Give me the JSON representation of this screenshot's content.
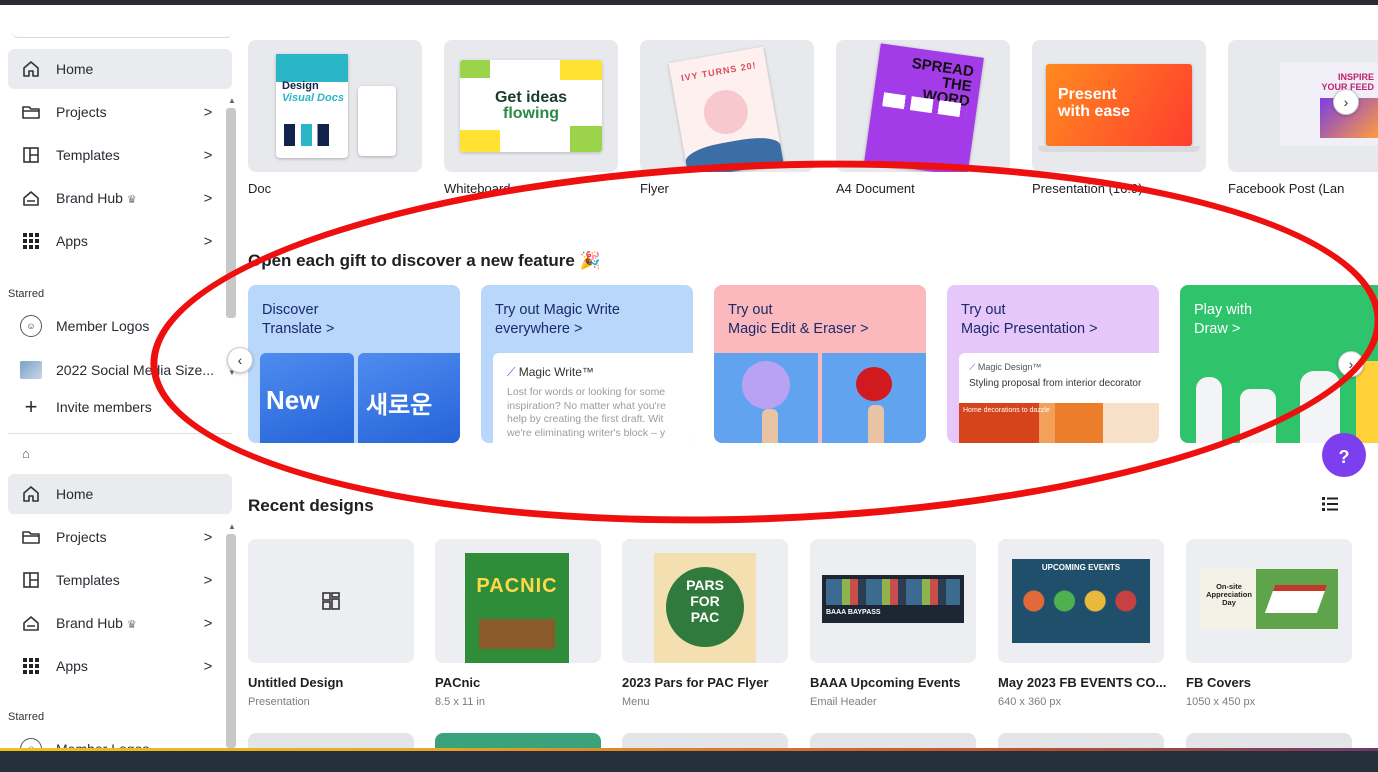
{
  "sidebar_top": {
    "items": [
      {
        "label": "Home",
        "icon": "home-icon",
        "active": true
      },
      {
        "label": "Projects",
        "icon": "folder-icon",
        "chevron": ">"
      },
      {
        "label": "Templates",
        "icon": "templates-icon",
        "chevron": ">"
      },
      {
        "label": "Brand Hub",
        "icon": "brand-hub-icon",
        "crown": "♛",
        "chevron": ">"
      },
      {
        "label": "Apps",
        "icon": "apps-grid-icon",
        "chevron": ">"
      }
    ],
    "starred_heading": "Starred",
    "starred": [
      {
        "label": "Member Logos",
        "icon": "member-logos-avatar"
      },
      {
        "label": "2022 Social Media Size...",
        "icon": "image-thumb-icon"
      }
    ],
    "invite": {
      "label": "Invite members",
      "icon": "plus-icon"
    }
  },
  "sidebar_bottom": {
    "items": [
      {
        "label": "Home",
        "icon": "home-icon",
        "active": true
      },
      {
        "label": "Projects",
        "icon": "folder-icon",
        "chevron": ">"
      },
      {
        "label": "Templates",
        "icon": "templates-icon",
        "chevron": ">"
      },
      {
        "label": "Brand Hub",
        "icon": "brand-hub-icon",
        "crown": "♛",
        "chevron": ">"
      },
      {
        "label": "Apps",
        "icon": "apps-grid-icon",
        "chevron": ">"
      }
    ],
    "starred_heading": "Starred",
    "starred_partial": "Member Logos"
  },
  "templates": [
    {
      "label": "Doc",
      "thumb_text": [
        "Design",
        "Visual Docs"
      ]
    },
    {
      "label": "Whiteboard",
      "thumb_text": [
        "Get ideas",
        "flowing"
      ]
    },
    {
      "label": "Flyer",
      "thumb_text": [
        "IVY TURNS 20!"
      ]
    },
    {
      "label": "A4 Document",
      "thumb_text": [
        "SPREAD",
        "THE WORD"
      ]
    },
    {
      "label": "Presentation (16:9)",
      "thumb_text": [
        "Present",
        "with ease"
      ]
    },
    {
      "label": "Facebook Post (Lan",
      "thumb_text": [
        "INSPIRE",
        "YOUR FEED"
      ]
    }
  ],
  "features": {
    "heading": "Open each gift to discover a new feature",
    "heading_emoji": "🎉",
    "cards": [
      {
        "line1": "Discover",
        "line2": "Translate >",
        "bg": "#b9d6fb",
        "art": [
          "New",
          "새로운"
        ]
      },
      {
        "line1": "Try out Magic Write",
        "line2": "everywhere >",
        "bg": "#b9d6fb",
        "panel_title": "Magic Write™",
        "panel_text": "Lost for words or looking for some inspiration? No matter what you're help by creating the first draft. Wit we're eliminating writer's block – y"
      },
      {
        "line1": "Try out",
        "line2": "Magic Edit & Eraser >",
        "bg": "#fbb9bd"
      },
      {
        "line1": "Try out",
        "line2": "Magic Presentation >",
        "bg": "#e5c7f9",
        "panel_title": "Magic Design™",
        "panel_text": "Styling proposal from interior decorator",
        "panel_strip": "Home decorations to dazzle"
      },
      {
        "line1": "Play with",
        "line2": "Draw >",
        "bg": "#2fc46b"
      }
    ]
  },
  "recent": {
    "heading": "Recent designs",
    "items": [
      {
        "title": "Untitled Design",
        "sub": "Presentation"
      },
      {
        "title": "PACnic",
        "sub": "8.5 x 11 in",
        "thumb": "PACNIC"
      },
      {
        "title": "2023 Pars for PAC Flyer",
        "sub": "Menu",
        "thumb": [
          "PARS",
          "FOR",
          "PAC"
        ]
      },
      {
        "title": "BAAA Upcoming Events",
        "sub": "Email Header",
        "thumb": "BAAA BAYPASS"
      },
      {
        "title": "May 2023  FB EVENTS CO...",
        "sub": "640 x 360 px",
        "thumb": "UPCOMING EVENTS"
      },
      {
        "title": "FB Covers",
        "sub": "1050 x 450 px",
        "thumb": [
          "On-site",
          "Appreciation",
          "Day"
        ]
      }
    ]
  },
  "nav": {
    "prev": "‹",
    "next": "›"
  },
  "help_label": "?",
  "annotation_color": "#ee0f0f",
  "accent_purple": "#7d3ef0"
}
